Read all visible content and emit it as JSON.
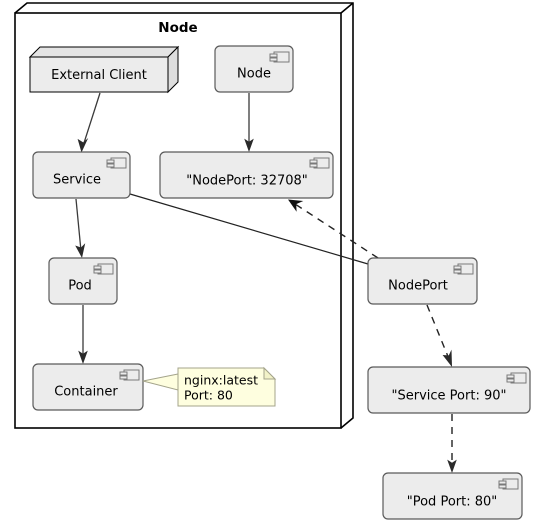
{
  "diagram": {
    "type": "uml-deployment",
    "title": "Node",
    "outer_node": {
      "label": "Node",
      "kind": "node-3d-container"
    },
    "nodes": [
      {
        "id": "external-client",
        "label": "External Client",
        "kind": "node-3d",
        "icon": "none"
      },
      {
        "id": "node-component",
        "label": "Node",
        "kind": "component",
        "icon": "component-icon"
      },
      {
        "id": "service",
        "label": "Service",
        "kind": "component",
        "icon": "component-icon"
      },
      {
        "id": "nodeport-literal",
        "label": "\"NodePort: 32708\"",
        "kind": "component",
        "icon": "component-icon"
      },
      {
        "id": "pod",
        "label": "Pod",
        "kind": "component",
        "icon": "component-icon"
      },
      {
        "id": "container",
        "label": "Container",
        "kind": "component",
        "icon": "component-icon"
      },
      {
        "id": "nodeport",
        "label": "NodePort",
        "kind": "component",
        "icon": "component-icon"
      },
      {
        "id": "service-port",
        "label": "\"Service Port: 90\"",
        "kind": "component",
        "icon": "component-icon"
      },
      {
        "id": "pod-port",
        "label": "\"Pod Port: 80\"",
        "kind": "component",
        "icon": "component-icon"
      }
    ],
    "note": {
      "id": "container-note",
      "lines": [
        "nginx:latest",
        "Port: 80"
      ],
      "attached_to": "container"
    },
    "edges": [
      {
        "id": "edge-client-service",
        "from": "external-client",
        "to": "service",
        "style": "solid",
        "arrow": "filled"
      },
      {
        "id": "edge-node-nodeport-literal",
        "from": "node-component",
        "to": "nodeport-literal",
        "style": "solid",
        "arrow": "filled"
      },
      {
        "id": "edge-service-pod",
        "from": "service",
        "to": "pod",
        "style": "solid",
        "arrow": "filled"
      },
      {
        "id": "edge-pod-container",
        "from": "pod",
        "to": "container",
        "style": "solid",
        "arrow": "filled"
      },
      {
        "id": "edge-service-nodeport",
        "from": "service",
        "to": "nodeport",
        "style": "solid",
        "arrow": "none"
      },
      {
        "id": "edge-nodeport-literal-dashed",
        "from": "nodeport",
        "to": "nodeport-literal",
        "style": "dashed",
        "arrow": "filled"
      },
      {
        "id": "edge-nodeport-serviceport",
        "from": "nodeport",
        "to": "service-port",
        "style": "dashed",
        "arrow": "filled"
      },
      {
        "id": "edge-serviceport-podport",
        "from": "service-port",
        "to": "pod-port",
        "style": "dashed",
        "arrow": "filled"
      }
    ],
    "colors": {
      "component_fill": "#ECECEC",
      "component_stroke": "#5A5A5A",
      "note_fill": "#FEFEDF",
      "note_stroke": "#A4A48B",
      "edge_stroke": "#222222",
      "outer_stroke": "#000000",
      "background": "#FFFFFF"
    }
  }
}
